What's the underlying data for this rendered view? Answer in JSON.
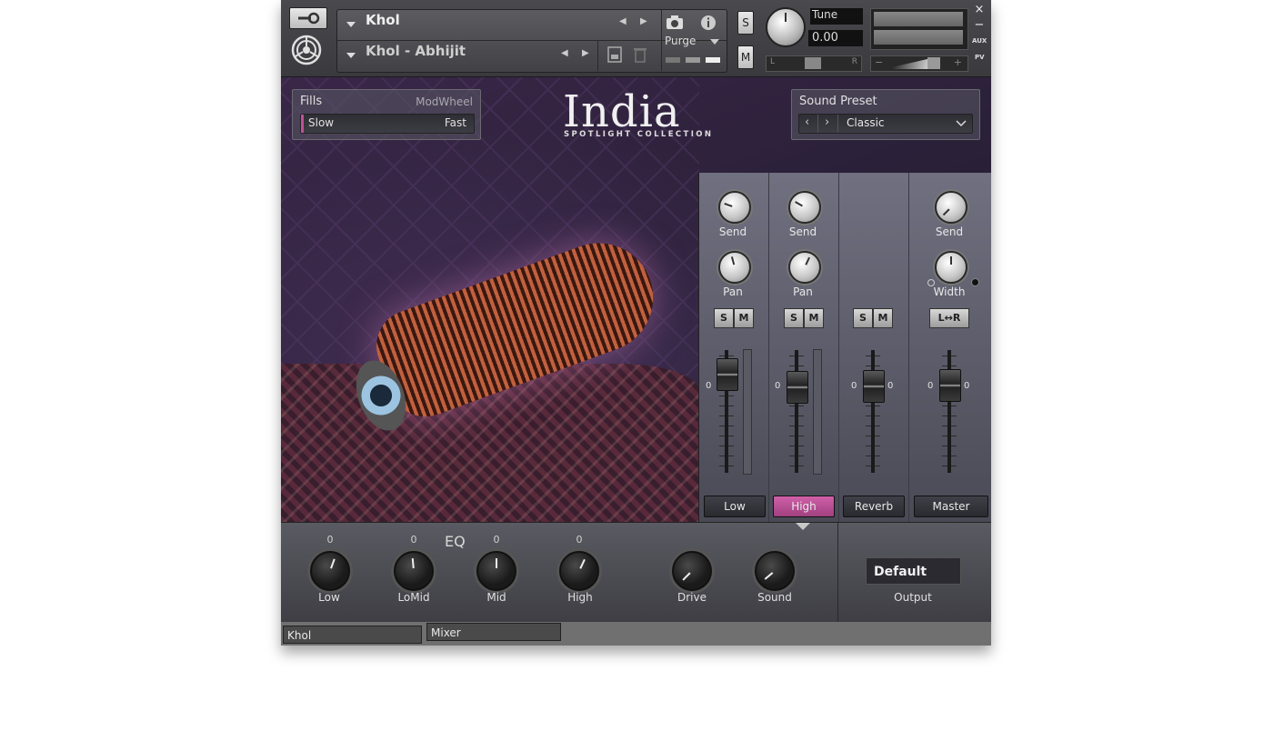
{
  "header": {
    "instrument_name": "Khol",
    "patch_name": "Khol - Abhijit",
    "purge_label": "Purge",
    "solo_label": "S",
    "mute_label": "M",
    "tune_label": "Tune",
    "tune_value": "0.00",
    "pan_left": "L",
    "pan_right": "R",
    "aux_label": "AUX",
    "pv_label": "PV",
    "close_label": "×",
    "minimize_label": "−",
    "vol_minus": "−",
    "vol_plus": "+"
  },
  "fills": {
    "label": "Fills",
    "source": "ModWheel",
    "slow": "Slow",
    "fast": "Fast"
  },
  "logo": {
    "title": "India",
    "subtitle": "SPOTLIGHT COLLECTION"
  },
  "sound_preset": {
    "label": "Sound Preset",
    "value": "Classic"
  },
  "mixer": {
    "channels": [
      {
        "knob1": "Send",
        "knob2": "Pan",
        "solo": "S",
        "mute": "M",
        "zero_left": "0",
        "name": "Low",
        "active": false
      },
      {
        "knob1": "Send",
        "knob2": "Pan",
        "solo": "S",
        "mute": "M",
        "zero_left": "0",
        "name": "High",
        "active": true
      },
      {
        "solo": "S",
        "mute": "M",
        "zero_left": "0",
        "zero_right": "0",
        "name": "Reverb",
        "active": false
      },
      {
        "knob1": "Send",
        "knob2": "Width",
        "lr": "L↔R",
        "zero_left": "0",
        "zero_right": "0",
        "name": "Master",
        "active": false
      }
    ]
  },
  "bottom": {
    "eq_label": "EQ",
    "knobs": [
      {
        "label": "Low",
        "value": "0"
      },
      {
        "label": "LoMid",
        "value": "0"
      },
      {
        "label": "Mid",
        "value": "0"
      },
      {
        "label": "High",
        "value": "0"
      },
      {
        "label": "Drive"
      },
      {
        "label": "Sound"
      }
    ],
    "output_value": "Default",
    "output_label": "Output"
  },
  "tabs": [
    "Khol",
    "Mixer"
  ],
  "colors": {
    "accent": "#c0509a"
  }
}
